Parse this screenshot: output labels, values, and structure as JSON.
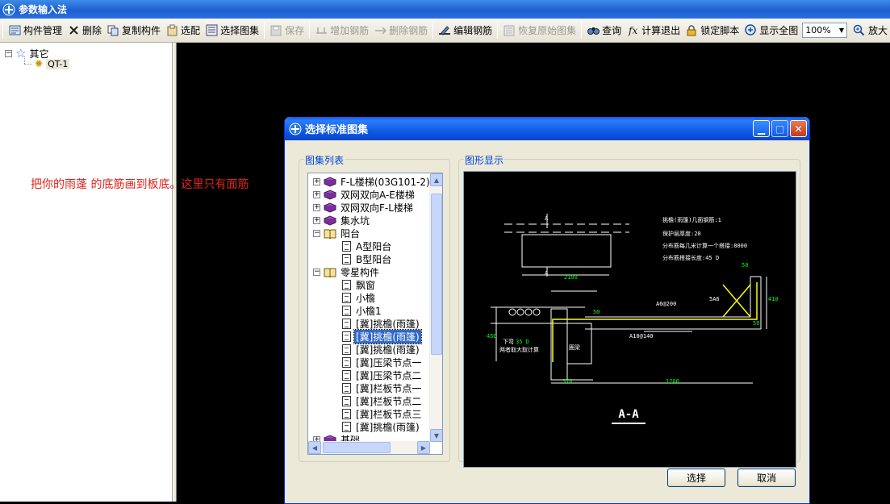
{
  "app": {
    "title": "参数输入法"
  },
  "toolbar": {
    "items": [
      {
        "label": "构件管理",
        "icon": "component-manage-icon",
        "enabled": true
      },
      {
        "label": "删除",
        "icon": "delete-icon",
        "enabled": true
      },
      {
        "label": "复制构件",
        "icon": "copy-icon",
        "enabled": true
      },
      {
        "label": "选配",
        "icon": "select-match-icon",
        "enabled": true
      },
      {
        "label": "选择图集",
        "icon": "atlas-icon",
        "enabled": true
      },
      {
        "label": "保存",
        "icon": "save-icon",
        "enabled": false
      },
      {
        "label": "增加钢筋",
        "icon": "add-rebar-icon",
        "enabled": false
      },
      {
        "label": "删除钢筋",
        "icon": "delete-rebar-icon",
        "enabled": false
      },
      {
        "label": "编辑钢筋",
        "icon": "edit-rebar-icon",
        "enabled": true
      },
      {
        "label": "恢复原始图集",
        "icon": "restore-icon",
        "enabled": false
      },
      {
        "label": "查询",
        "icon": "query-icon",
        "enabled": true
      },
      {
        "label": "计算退出",
        "icon": "calc-exit-icon",
        "enabled": true
      },
      {
        "label": "锁定脚本",
        "icon": "lock-icon",
        "enabled": true
      },
      {
        "label": "显示全图",
        "icon": "zoom-fit-icon",
        "enabled": true
      }
    ],
    "zoom": "100%",
    "zoom_in_label": "放大"
  },
  "tree": {
    "root": "其它",
    "child": "QT-1"
  },
  "annotation": "把你的雨蓬 的底筋画到板底。这里只有面筋",
  "dialog": {
    "title": "选择标准图集",
    "list_group_label": "图集列表",
    "preview_group_label": "图形显示",
    "list_items": [
      {
        "label": "F-L楼梯(03G101-2)",
        "kind": "book",
        "expander": "+"
      },
      {
        "label": "双网双向A-E楼梯",
        "kind": "book",
        "expander": "+"
      },
      {
        "label": "双网双向F-L楼梯",
        "kind": "book",
        "expander": "+"
      },
      {
        "label": "集水坑",
        "kind": "book",
        "expander": "+"
      },
      {
        "label": "阳台",
        "kind": "openbook",
        "expander": "-"
      },
      {
        "label": "A型阳台",
        "kind": "doc",
        "expander": ""
      },
      {
        "label": "B型阳台",
        "kind": "doc",
        "expander": ""
      },
      {
        "label": "零星构件",
        "kind": "openbook",
        "expander": "-"
      },
      {
        "label": "飘窗",
        "kind": "doc",
        "expander": ""
      },
      {
        "label": "小檐",
        "kind": "doc",
        "expander": ""
      },
      {
        "label": "小檐1",
        "kind": "doc",
        "expander": ""
      },
      {
        "label": "[冀]挑檐(雨篷)",
        "kind": "doc",
        "expander": ""
      },
      {
        "label": "[冀]挑檐(雨篷)",
        "kind": "doc",
        "expander": "",
        "selected": true
      },
      {
        "label": "[冀]挑檐(雨篷)",
        "kind": "doc",
        "expander": ""
      },
      {
        "label": "[冀]压梁节点一",
        "kind": "doc",
        "expander": ""
      },
      {
        "label": "[冀]压梁节点二",
        "kind": "doc",
        "expander": ""
      },
      {
        "label": "[冀]栏板节点一",
        "kind": "doc",
        "expander": ""
      },
      {
        "label": "[冀]栏板节点二",
        "kind": "doc",
        "expander": ""
      },
      {
        "label": "[冀]栏板节点三",
        "kind": "doc",
        "expander": ""
      },
      {
        "label": "[冀]挑檐(雨篷)",
        "kind": "doc",
        "expander": ""
      },
      {
        "label": "基础",
        "kind": "book",
        "expander": "+"
      }
    ],
    "select_button": "选择",
    "cancel_button": "取消"
  },
  "cad": {
    "params": [
      "挑檐(雨篷)几面钢筋:1",
      "保护层厚度:20",
      "分布筋每几米计算一个搭接:8000",
      "分布筋搭接长度:45",
      "D"
    ],
    "dims": {
      "width_top": "2100",
      "right_top": "50",
      "right_h": "410",
      "right_bottom": "50",
      "left_h": "450",
      "bottom_left": "370",
      "bottom_right": "1200"
    },
    "labels": {
      "a_top": "A",
      "a_bottom": "A",
      "rebar1": "A6@200",
      "rebar2": "A10@140",
      "rebar3": "5A6",
      "dim_50": "50",
      "note1": "下弯",
      "note1_val": "35 D",
      "note2": "两者取大取计算",
      "beam_label": "圈梁"
    },
    "section_title": "A-A",
    "colors": {
      "line": "#ffffff",
      "rebar": "#ffff00",
      "text": "#ffffff",
      "value": "#00ff00"
    }
  },
  "colors": {
    "accent": "#316ac5",
    "annotation": "#e0231a",
    "titlebar": "#1e5fd0"
  }
}
